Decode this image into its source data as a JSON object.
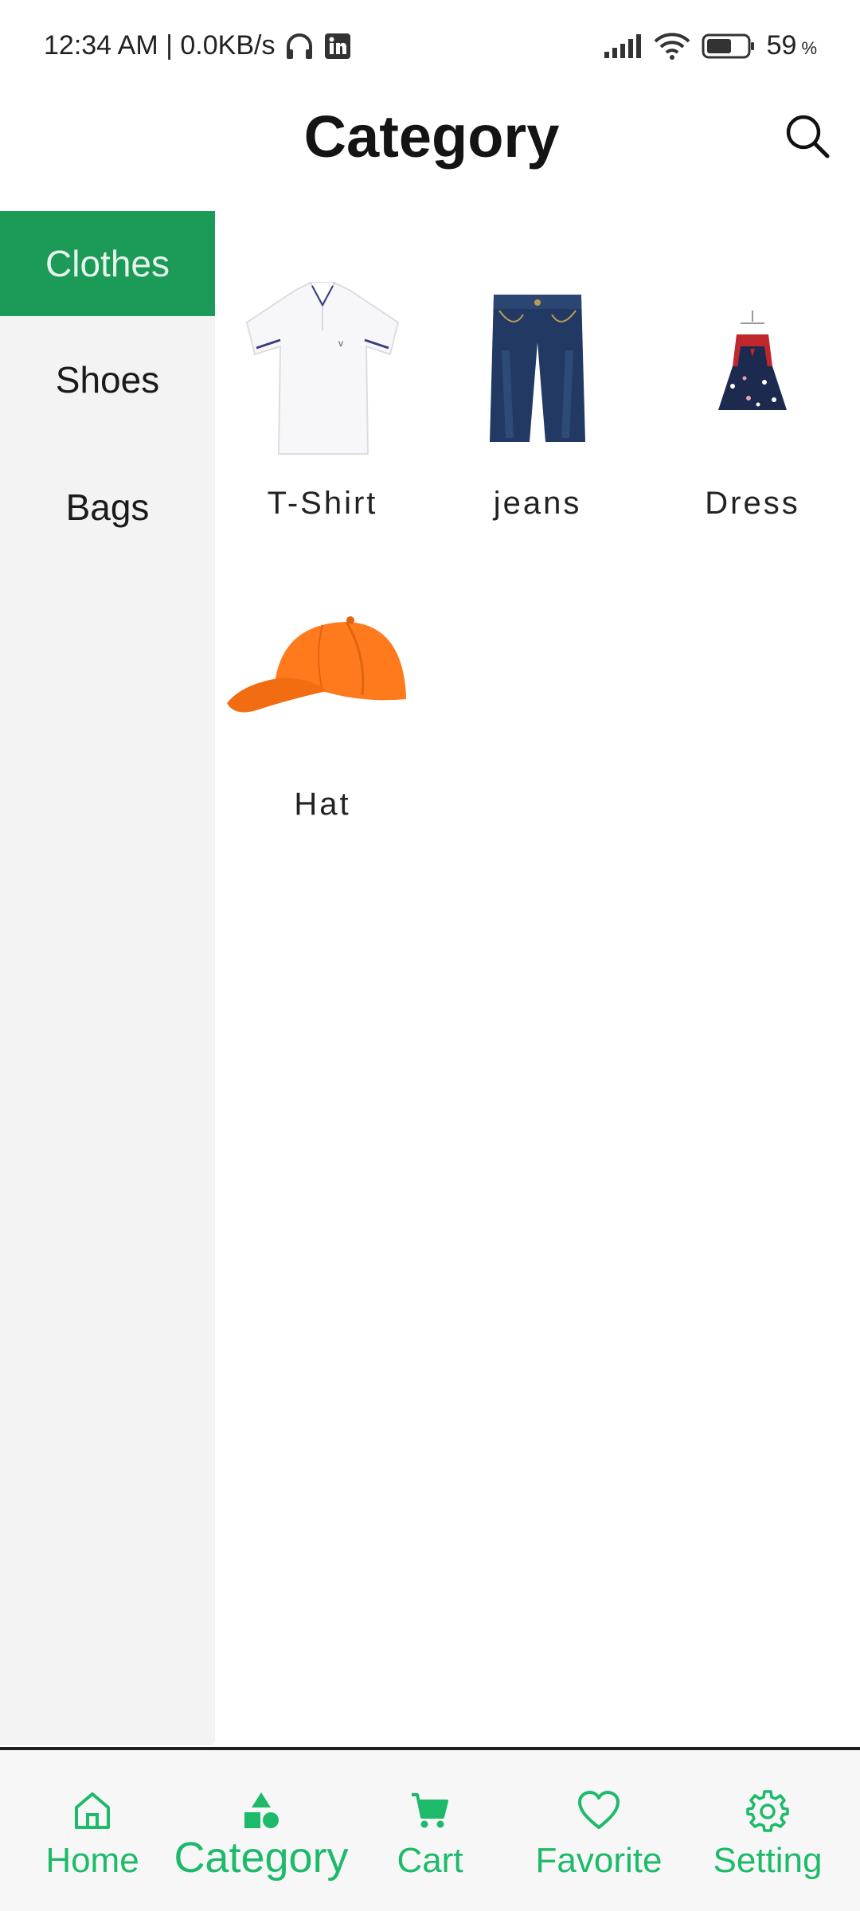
{
  "status_bar": {
    "time": "12:34 AM | 0.0KB/s",
    "battery_percent": "59",
    "battery_suffix": "%",
    "icons": [
      "headphones-icon",
      "linkedin-icon",
      "signal-icon",
      "wifi-icon",
      "battery-icon"
    ]
  },
  "header": {
    "title": "Category",
    "search_icon": "search-icon"
  },
  "sidebar": {
    "items": [
      {
        "label": "Clothes",
        "active": true
      },
      {
        "label": "Shoes",
        "active": false
      },
      {
        "label": "Bags",
        "active": false
      }
    ],
    "active_color": "#1b9a58"
  },
  "products": [
    {
      "name": "T-Shirt",
      "image": "polo-shirt-image"
    },
    {
      "name": "jeans",
      "image": "jeans-image"
    },
    {
      "name": "Dress",
      "image": "dress-image"
    },
    {
      "name": "Hat",
      "image": "cap-image"
    }
  ],
  "bottom_nav": {
    "accent_color": "#1dba6a",
    "items": [
      {
        "label": "Home",
        "icon": "home-icon",
        "active": false
      },
      {
        "label": "Category",
        "icon": "category-icon",
        "active": true
      },
      {
        "label": "Cart",
        "icon": "cart-icon",
        "active": false
      },
      {
        "label": "Favorite",
        "icon": "heart-icon",
        "active": false
      },
      {
        "label": "Setting",
        "icon": "gear-icon",
        "active": false
      }
    ]
  }
}
